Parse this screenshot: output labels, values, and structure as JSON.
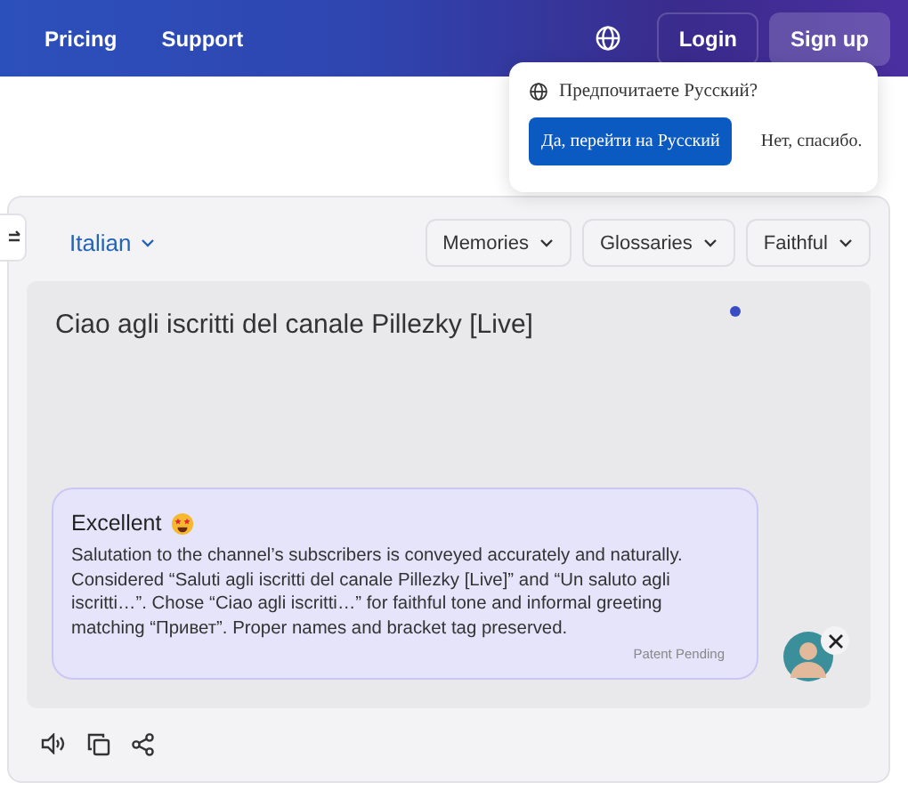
{
  "nav": {
    "links": [
      "Pricing",
      "Support"
    ],
    "login": "Login",
    "signup": "Sign up"
  },
  "language_prompt": {
    "question": "Предпочитаете Русский?",
    "accept": "Да, перейти на Русский",
    "decline": "Нет, спасибо."
  },
  "translator": {
    "target_language": "Italian",
    "options": [
      "Memories",
      "Glossaries",
      "Faithful"
    ],
    "output": "Ciao agli iscritti del canale Pillezky [Live]",
    "feedback": {
      "rating": "Excellent",
      "text": "Salutation to the channel’s subscribers is conveyed accurately and naturally. Considered “Saluti agli iscritti del canale Pillezky [Live]” and “Un saluto agli iscritti…”. Chose “Ciao agli iscritti…” for faithful tone and informal greeting matching “Привет”. Proper names and bracket tag preserved.",
      "footnote": "Patent Pending"
    }
  }
}
